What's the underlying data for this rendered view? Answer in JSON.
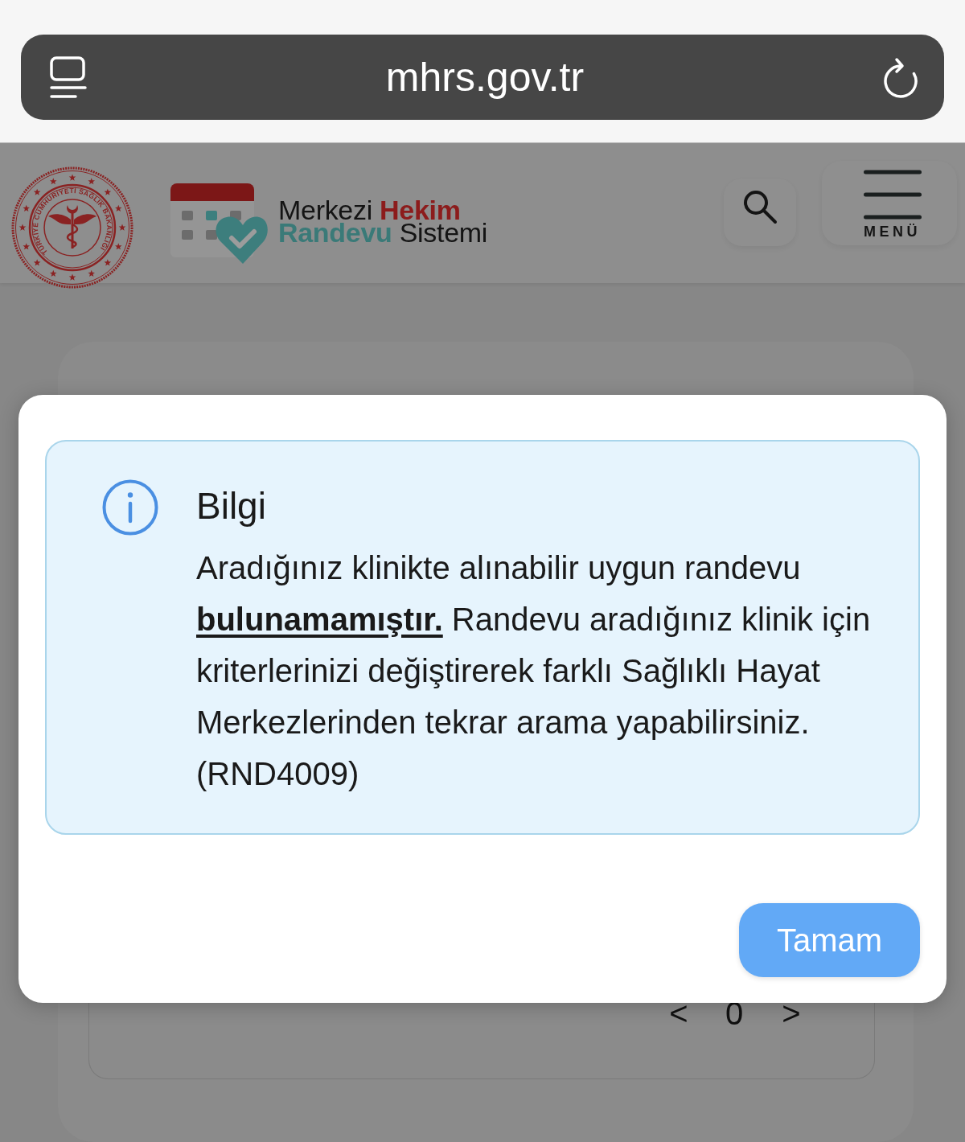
{
  "browser": {
    "url": "mhrs.gov.tr"
  },
  "header": {
    "seal_text": "TÜRKİYE CUMHURİYETİ SAĞLIK BAKANLIĞI",
    "logo_lines": [
      {
        "parts": [
          {
            "text": "Merkezi",
            "bold": false,
            "color": "#141414"
          },
          {
            "text": "Hekim",
            "bold": true,
            "color": "#8c1c1c"
          }
        ]
      },
      {
        "parts": [
          {
            "text": "Randevu",
            "bold": true,
            "color": "#3a7a78"
          },
          {
            "text": "Sistemi",
            "bold": false,
            "color": "#141414"
          }
        ]
      }
    ],
    "menu_label": "MENÜ"
  },
  "page": {
    "pager": {
      "prev": "<",
      "page": "0",
      "next": ">"
    }
  },
  "dialog": {
    "kind": "info",
    "title": "Bilgi",
    "message": "Aradığınız klinikte alınabilir uygun randevu **bulunamamıştır.** Randevu aradığınız klinik için kriterlerinizi değiştirerek farklı Sağlıklı Hayat Merkezlerinden tekrar arama yapabilirsiniz. (RND4009)",
    "button": "Tamam"
  }
}
